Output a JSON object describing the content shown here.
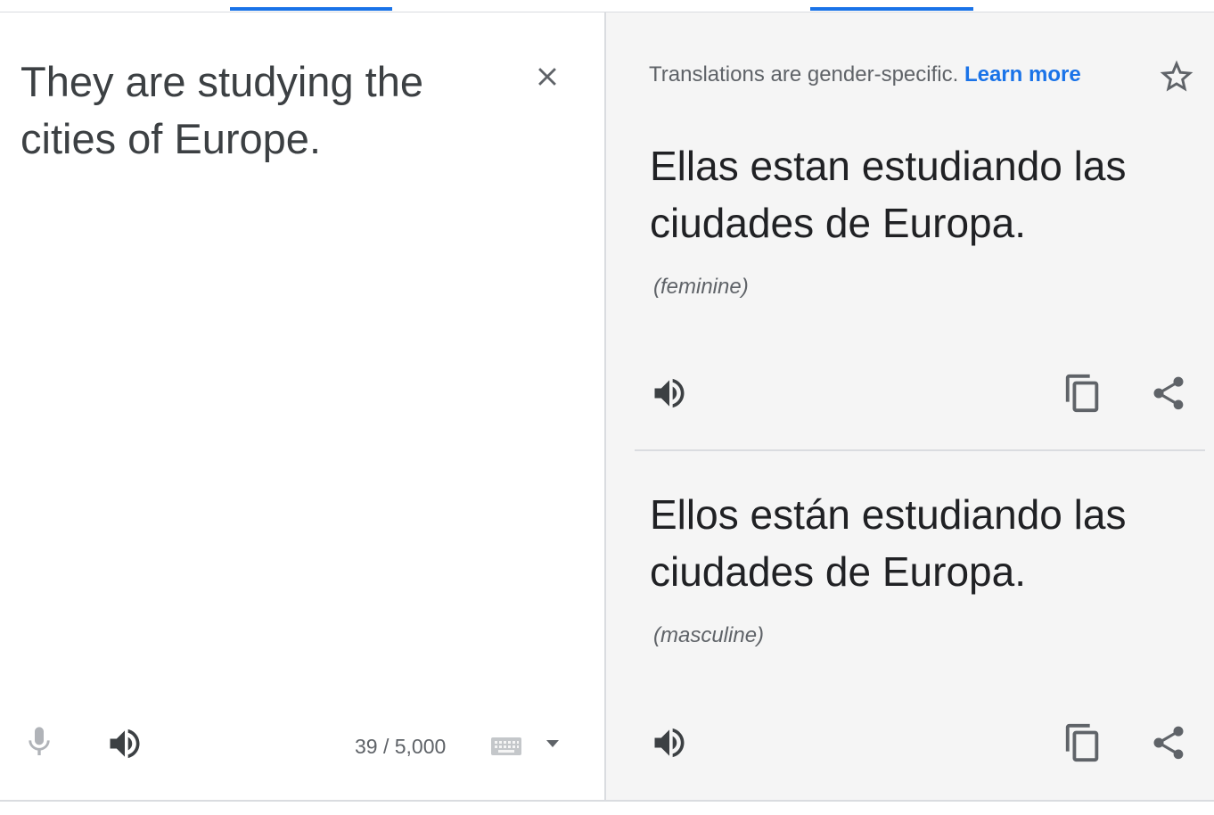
{
  "source": {
    "text": "They are studying the cities of Europe.",
    "char_count": "39 / 5,000",
    "icons": {
      "clear": "close-icon",
      "mic": "microphone-icon",
      "speaker": "speaker-icon",
      "keyboard": "keyboard-icon",
      "dropdown": "caret-down-icon"
    }
  },
  "target": {
    "notice": "Translations are gender-specific.",
    "learn_more": "Learn more",
    "translations": [
      {
        "text": "Ellas estan estudiando las ciudades de Europa.",
        "gender": "(feminine)"
      },
      {
        "text": "Ellos están estudiando las ciudades de Europa.",
        "gender": "(masculine)"
      }
    ],
    "icons": {
      "star": "star-icon",
      "speaker": "speaker-icon",
      "copy": "copy-icon",
      "share": "share-icon"
    }
  },
  "colors": {
    "accent": "#1a73e8",
    "target_background": "#f5f5f5",
    "text_primary": "#202124",
    "text_secondary": "#5f6368"
  }
}
